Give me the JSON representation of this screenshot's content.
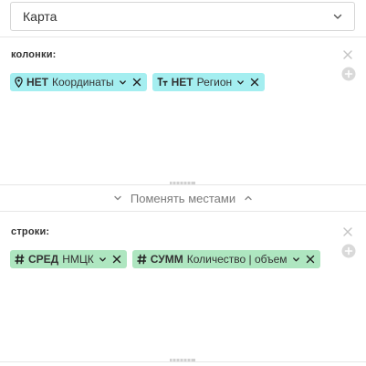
{
  "select": {
    "value": "Карта",
    "icon": "chevron-down-icon"
  },
  "columns": {
    "label": "колонки:",
    "chips": [
      {
        "icon": "location-pin-icon",
        "agg": "НЕТ",
        "name": "Координаты",
        "color": "#a4eef0"
      },
      {
        "icon": "text-type-icon",
        "agg": "НЕТ",
        "name": "Регион",
        "color": "#a4eef0"
      }
    ]
  },
  "swap": {
    "label": "Поменять местами"
  },
  "rows": {
    "label": "строки:",
    "chips": [
      {
        "icon": "hash-icon",
        "agg": "СРЕД",
        "name": "НМЦК",
        "color": "#aee6c0"
      },
      {
        "icon": "hash-icon",
        "agg": "СУММ",
        "name": "Количество | объем",
        "color": "#aee6c0"
      }
    ]
  }
}
